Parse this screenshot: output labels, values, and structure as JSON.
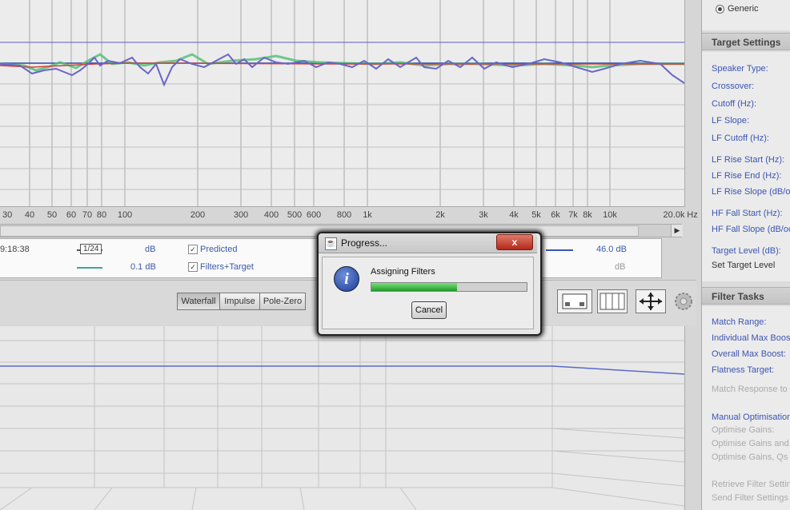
{
  "graph": {
    "x_ticks": [
      "30",
      "40",
      "50",
      "60",
      "70",
      "80",
      "100",
      "200",
      "300",
      "400",
      "500",
      "600",
      "800",
      "1k",
      "2k",
      "3k",
      "4k",
      "5k",
      "6k",
      "7k",
      "8k",
      "10k",
      "20.0k",
      "Hz"
    ]
  },
  "legend": {
    "time": "9:18:38",
    "octave": "1/24",
    "db_label_1": "dB",
    "predicted_check": "✓",
    "predicted_label": "Predicted",
    "db_value_2": "0.1 dB",
    "filters_check": "✓",
    "filters_label": "Filters+Target",
    "level_value": "46.0 dB",
    "db_label_2": "dB"
  },
  "lower_toolbar": {
    "tabs": [
      "Waterfall",
      "Impulse",
      "Pole-Zero"
    ]
  },
  "right_panel": {
    "generic_label": "Generic",
    "target_settings": {
      "header": "Target Settings",
      "items": [
        "Speaker Type:",
        "Crossover:",
        "Cutoff (Hz):",
        "LF Slope:",
        "LF Cutoff (Hz):",
        "LF Rise Start (Hz):",
        "LF Rise End (Hz):",
        "LF Rise Slope (dB/oc",
        "HF Fall Start (Hz):",
        "HF Fall Slope (dB/oct",
        "Target Level (dB):",
        "Set Target Level"
      ]
    },
    "filter_tasks": {
      "header": "Filter Tasks",
      "items": [
        "Match Range:",
        "Individual Max Boost",
        "Overall Max Boost:",
        "Flatness Target:",
        "Match Response to",
        "Manual Optimisation",
        "Optimise Gains:",
        "Optimise Gains and",
        "Optimise Gains, Qs a",
        "Retrieve Filter Setting",
        "Send Filter Settings t"
      ]
    }
  },
  "dialog": {
    "title": "Progress...",
    "close": "x",
    "message": "Assigning Filters",
    "progress": 0.55,
    "cancel": "Cancel"
  },
  "colors": {
    "trace_blue": "#6a66c8",
    "trace_green": "#4fbf70",
    "trace_red": "#d04040",
    "progress_green": "#2aa834",
    "link_blue": "#3c54b4"
  }
}
